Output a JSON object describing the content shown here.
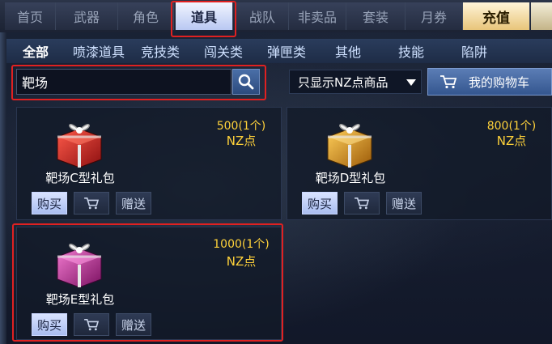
{
  "top_tabs": [
    {
      "label": "首页"
    },
    {
      "label": "武器"
    },
    {
      "label": "角色"
    },
    {
      "label": "道具",
      "active": true
    },
    {
      "label": "战队"
    },
    {
      "label": "非卖品"
    },
    {
      "label": "套装"
    },
    {
      "label": "月券"
    },
    {
      "label": "充值"
    }
  ],
  "sub_tabs": [
    {
      "label": "全部",
      "active": true
    },
    {
      "label": "喷漆道具"
    },
    {
      "label": "竞技类"
    },
    {
      "label": "闯关类"
    },
    {
      "label": "弹匣类"
    },
    {
      "label": "其他"
    },
    {
      "label": "技能"
    },
    {
      "label": "陷阱"
    }
  ],
  "search": {
    "value": "靶场"
  },
  "filter": {
    "selected": "只显示NZ点商品"
  },
  "cart": {
    "label": "我的购物车"
  },
  "products": [
    {
      "name": "靶场C型礼包",
      "price": "500(1个)",
      "currency": "NZ点",
      "color": "red",
      "buy": "购买",
      "gift": "赠送"
    },
    {
      "name": "靶场D型礼包",
      "price": "800(1个)",
      "currency": "NZ点",
      "color": "gold",
      "buy": "购买",
      "gift": "赠送"
    },
    {
      "name": "靶场E型礼包",
      "price": "1000(1个)",
      "currency": "NZ点",
      "color": "pink",
      "buy": "购买",
      "gift": "赠送"
    }
  ],
  "colors": {
    "highlight": "#e02121",
    "price": "#ffd23a",
    "active_tab": "#c9d6ff"
  }
}
